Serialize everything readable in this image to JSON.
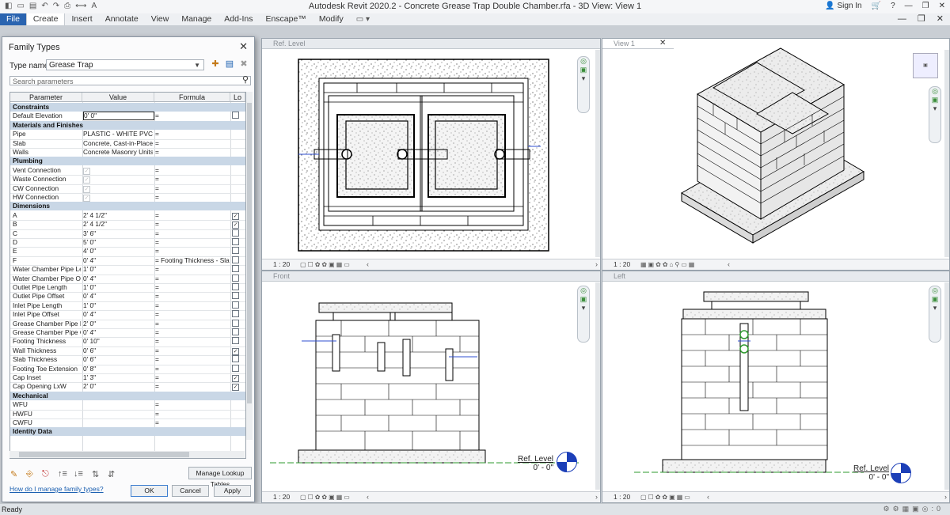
{
  "title": "Autodesk Revit 2020.2 - Concrete Grease Trap Double Chamber.rfa - 3D View: View 1",
  "sign_in": "Sign In",
  "ribbon_tabs": [
    "File",
    "Create",
    "Insert",
    "Annotate",
    "View",
    "Manage",
    "Add-Ins",
    "Enscape™",
    "Modify"
  ],
  "active_tab": "Create",
  "views": {
    "ref_level": {
      "tab": "Ref. Level",
      "scale": "1 : 20"
    },
    "view1": {
      "tab": "View 1",
      "scale": "1 : 20"
    },
    "front": {
      "tab": "Front",
      "scale": "1 : 20",
      "level_label": "Ref. Level",
      "level_value": "0' - 0\""
    },
    "left": {
      "tab": "Left",
      "scale": "1 : 20",
      "level_label": "Ref. Level",
      "level_value": "0' - 0\""
    }
  },
  "dialog": {
    "title": "Family Types",
    "type_name_label": "Type name:",
    "type_name": "Grease Trap",
    "search_placeholder": "Search parameters",
    "columns": [
      "Parameter",
      "Value",
      "Formula",
      "Lo"
    ],
    "groups": [
      {
        "name": "Constraints",
        "rows": [
          {
            "param": "Default Elevation",
            "value": "0'  0\"",
            "formula": "=",
            "lock": "off"
          }
        ]
      },
      {
        "name": "Materials and Finishes",
        "rows": [
          {
            "param": "Pipe",
            "value": "PLASTIC - WHITE PVC",
            "formula": "=",
            "lock": ""
          },
          {
            "param": "Slab",
            "value": "Concrete, Cast-in-Place",
            "formula": "=",
            "lock": ""
          },
          {
            "param": "Walls",
            "value": "Concrete Masonry Units",
            "formula": "=",
            "lock": ""
          }
        ]
      },
      {
        "name": "Plumbing",
        "rows": [
          {
            "param": "Vent Connection",
            "value": "",
            "formula": "=",
            "lock": "",
            "check": true
          },
          {
            "param": "Waste Connection",
            "value": "",
            "formula": "=",
            "lock": "",
            "check": true
          },
          {
            "param": "CW Connection",
            "value": "",
            "formula": "=",
            "lock": "",
            "check": true
          },
          {
            "param": "HW Connection",
            "value": "",
            "formula": "=",
            "lock": "",
            "check": true
          }
        ]
      },
      {
        "name": "Dimensions",
        "rows": [
          {
            "param": "A",
            "value": "2'  4 1/2\"",
            "formula": "=",
            "lock": "on"
          },
          {
            "param": "B",
            "value": "2'  4 1/2\"",
            "formula": "=",
            "lock": "on"
          },
          {
            "param": "C",
            "value": "3'  6\"",
            "formula": "=",
            "lock": "off"
          },
          {
            "param": "D",
            "value": "5'  0\"",
            "formula": "=",
            "lock": "off"
          },
          {
            "param": "E",
            "value": "4'  0\"",
            "formula": "=",
            "lock": "off"
          },
          {
            "param": "F",
            "value": "0'  4\"",
            "formula": "= Footing Thickness - Slab T",
            "lock": "off"
          },
          {
            "param": "Water Chamber Pipe Lengt",
            "value": "1'  0\"",
            "formula": "=",
            "lock": "off"
          },
          {
            "param": "Water Chamber Pipe Offse",
            "value": "0'  4\"",
            "formula": "=",
            "lock": "off"
          },
          {
            "param": "Outlet Pipe Length",
            "value": "1'  0\"",
            "formula": "=",
            "lock": "off"
          },
          {
            "param": "Outlet Pipe Offset",
            "value": "0'  4\"",
            "formula": "=",
            "lock": "off"
          },
          {
            "param": "Inlet Pipe Length",
            "value": "1'  0\"",
            "formula": "=",
            "lock": "off"
          },
          {
            "param": "Inlet Pipe Offset",
            "value": "0'  4\"",
            "formula": "=",
            "lock": "off"
          },
          {
            "param": "Grease Chamber Pipe Leng",
            "value": "2'  0\"",
            "formula": "=",
            "lock": "off"
          },
          {
            "param": "Grease Chamber Pipe Offs",
            "value": "0'  4\"",
            "formula": "=",
            "lock": "off"
          },
          {
            "param": "Footing Thickness",
            "value": "0'  10\"",
            "formula": "=",
            "lock": "off"
          },
          {
            "param": "Wall Thickness",
            "value": "0'  6\"",
            "formula": "=",
            "lock": "on"
          },
          {
            "param": "Slab Thickness",
            "value": "0'  6\"",
            "formula": "=",
            "lock": "off"
          },
          {
            "param": "Footing Toe Extension",
            "value": "0'  8\"",
            "formula": "=",
            "lock": "off"
          },
          {
            "param": "Cap Inset",
            "value": "1'  3\"",
            "formula": "=",
            "lock": "on"
          },
          {
            "param": "Cap Opening LxW",
            "value": "2'  0\"",
            "formula": "=",
            "lock": "on"
          }
        ]
      },
      {
        "name": "Mechanical",
        "rows": [
          {
            "param": "WFU",
            "value": "",
            "formula": "=",
            "lock": ""
          },
          {
            "param": "HWFU",
            "value": "",
            "formula": "=",
            "lock": ""
          },
          {
            "param": "CWFU",
            "value": "",
            "formula": "=",
            "lock": ""
          }
        ]
      },
      {
        "name": "Identity Data",
        "rows": []
      }
    ],
    "manage_lookup": "Manage Lookup Tables",
    "help_link": "How do I manage family types?",
    "ok": "OK",
    "cancel": "Cancel",
    "apply": "Apply"
  },
  "status": "Ready",
  "status_right": ":0"
}
